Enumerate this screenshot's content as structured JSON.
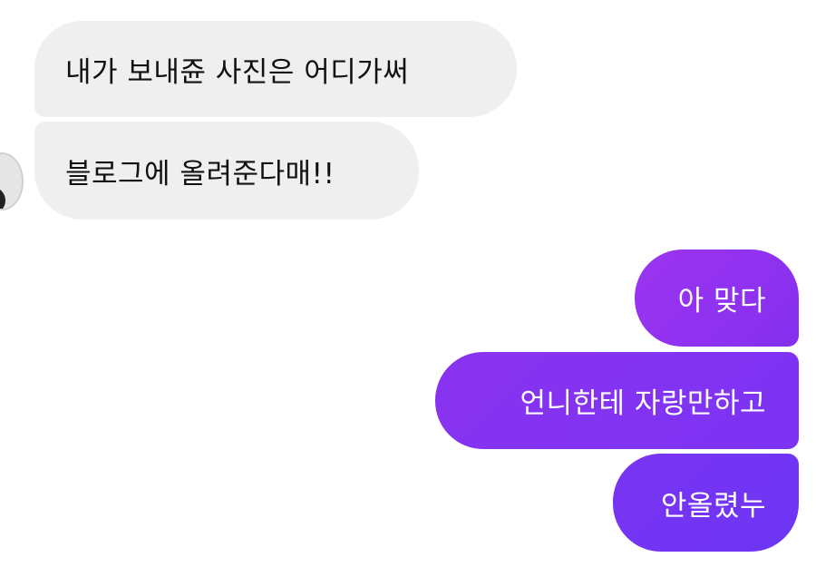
{
  "incoming": [
    {
      "text": "내가 보내쥰 사진은 어디가써"
    },
    {
      "text": "블로그에 올려준다매!!"
    }
  ],
  "outgoing": [
    {
      "text": "아 맞다"
    },
    {
      "text": "언니한테 자랑만하고"
    },
    {
      "text": "안올렸누"
    }
  ],
  "colors": {
    "incoming_bubble": "#efefef",
    "outgoing_gradient_start": "#9c34f0",
    "outgoing_gradient_end": "#6d35f4",
    "incoming_text": "#111111",
    "outgoing_text": "#ffffff"
  }
}
